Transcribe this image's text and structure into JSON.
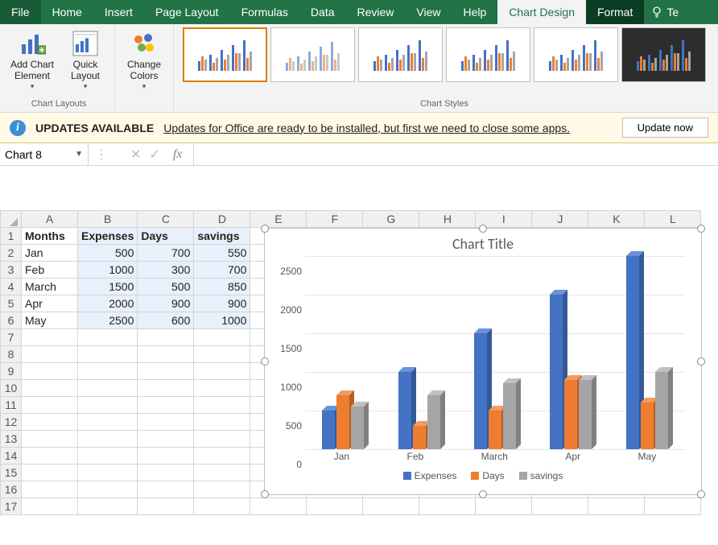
{
  "ribbon": {
    "tabs": {
      "file": "File",
      "home": "Home",
      "insert": "Insert",
      "pagelayout": "Page Layout",
      "formulas": "Formulas",
      "data": "Data",
      "review": "Review",
      "view": "View",
      "help": "Help",
      "chartdesign": "Chart Design",
      "format": "Format",
      "tellme": "Te"
    },
    "groups": {
      "chart_layouts": {
        "label": "Chart Layouts",
        "add_chart_element": "Add Chart Element",
        "quick_layout": "Quick Layout"
      },
      "change_colors": "Change Colors",
      "chart_styles_label": "Chart Styles"
    }
  },
  "banner": {
    "title": "UPDATES AVAILABLE",
    "message": "Updates for Office are ready to be installed, but first we need to close some apps.",
    "button": "Update now"
  },
  "formula_bar": {
    "name_box": "Chart 8",
    "fx": "fx",
    "formula": ""
  },
  "grid": {
    "columns": [
      "A",
      "B",
      "C",
      "D",
      "E",
      "F",
      "G",
      "H",
      "I",
      "J",
      "K",
      "L"
    ],
    "headers": {
      "A": "Months",
      "B": "Expenses",
      "C": "Days",
      "D": "savings"
    },
    "rows": [
      {
        "r": 1
      },
      {
        "r": 2,
        "A": "Jan",
        "B": 500,
        "C": 700,
        "D": 550
      },
      {
        "r": 3,
        "A": "Feb",
        "B": 1000,
        "C": 300,
        "D": 700
      },
      {
        "r": 4,
        "A": "March",
        "B": 1500,
        "C": 500,
        "D": 850
      },
      {
        "r": 5,
        "A": "Apr",
        "B": 2000,
        "C": 900,
        "D": 900
      },
      {
        "r": 6,
        "A": "May",
        "B": 2500,
        "C": 600,
        "D": 1000
      },
      {
        "r": 7
      },
      {
        "r": 8
      },
      {
        "r": 9
      },
      {
        "r": 10
      },
      {
        "r": 11
      },
      {
        "r": 12
      },
      {
        "r": 13
      },
      {
        "r": 14
      },
      {
        "r": 15
      },
      {
        "r": 16
      },
      {
        "r": 17
      }
    ]
  },
  "chart_data": {
    "type": "bar",
    "title": "Chart Title",
    "categories": [
      "Jan",
      "Feb",
      "March",
      "Apr",
      "May"
    ],
    "series": [
      {
        "name": "Expenses",
        "values": [
          500,
          1000,
          1500,
          2000,
          2500
        ],
        "color": "#4472c4"
      },
      {
        "name": "Days",
        "values": [
          700,
          300,
          500,
          900,
          600
        ],
        "color": "#ed7d31"
      },
      {
        "name": "savings",
        "values": [
          550,
          700,
          850,
          900,
          1000
        ],
        "color": "#a5a5a5"
      }
    ],
    "xlabel": "",
    "ylabel": "",
    "ylim": [
      0,
      2500
    ],
    "yticks": [
      0,
      500,
      1000,
      1500,
      2000,
      2500
    ]
  }
}
